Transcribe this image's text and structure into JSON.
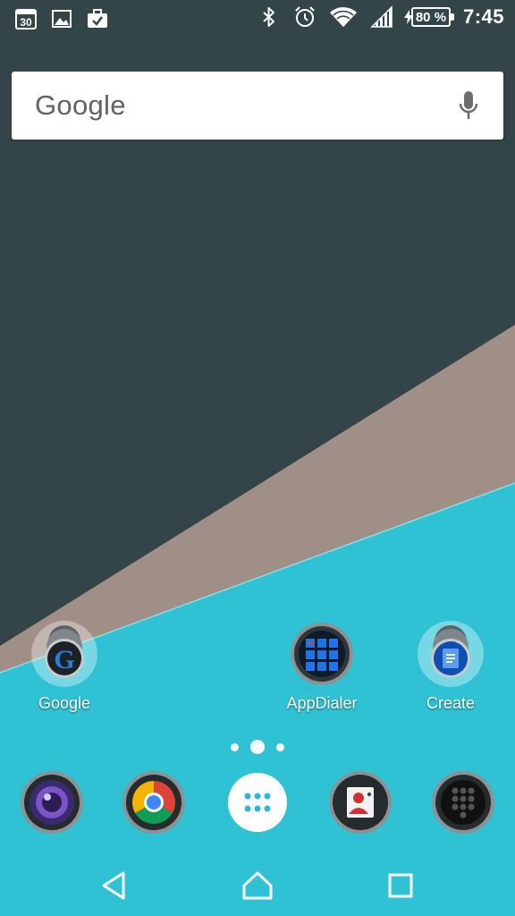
{
  "status_bar": {
    "left_icons": [
      "calendar-icon",
      "gallery-icon",
      "briefcase-check-icon"
    ],
    "calendar_day": "30",
    "right_icons": [
      "bluetooth-icon",
      "alarm-icon",
      "wifi-icon",
      "signal-icon"
    ],
    "battery_percent": "80 %",
    "time": "7:45"
  },
  "search": {
    "logo_text": "Google",
    "icon": "mic-icon"
  },
  "home_apps": [
    {
      "label": "Google",
      "icon": "google-folder-icon"
    },
    {
      "label": "AppDialer",
      "icon": "app-dialer-icon"
    },
    {
      "label": "Create",
      "icon": "create-folder-icon"
    }
  ],
  "page_indicator": {
    "pages": 3,
    "current": 2
  },
  "dock": [
    {
      "icon": "camera-icon"
    },
    {
      "icon": "chrome-icon"
    },
    {
      "icon": "app-drawer-icon"
    },
    {
      "icon": "contacts-icon"
    },
    {
      "icon": "phone-dialer-icon"
    }
  ],
  "nav_bar": {
    "buttons": [
      "back-icon",
      "home-icon",
      "recents-icon"
    ]
  },
  "colors": {
    "wallpaper_dark": "#344549",
    "wallpaper_taupe": "#a08f86",
    "wallpaper_cyan": "#2fc2d4",
    "drawer_dots": "#2fb8cf"
  }
}
